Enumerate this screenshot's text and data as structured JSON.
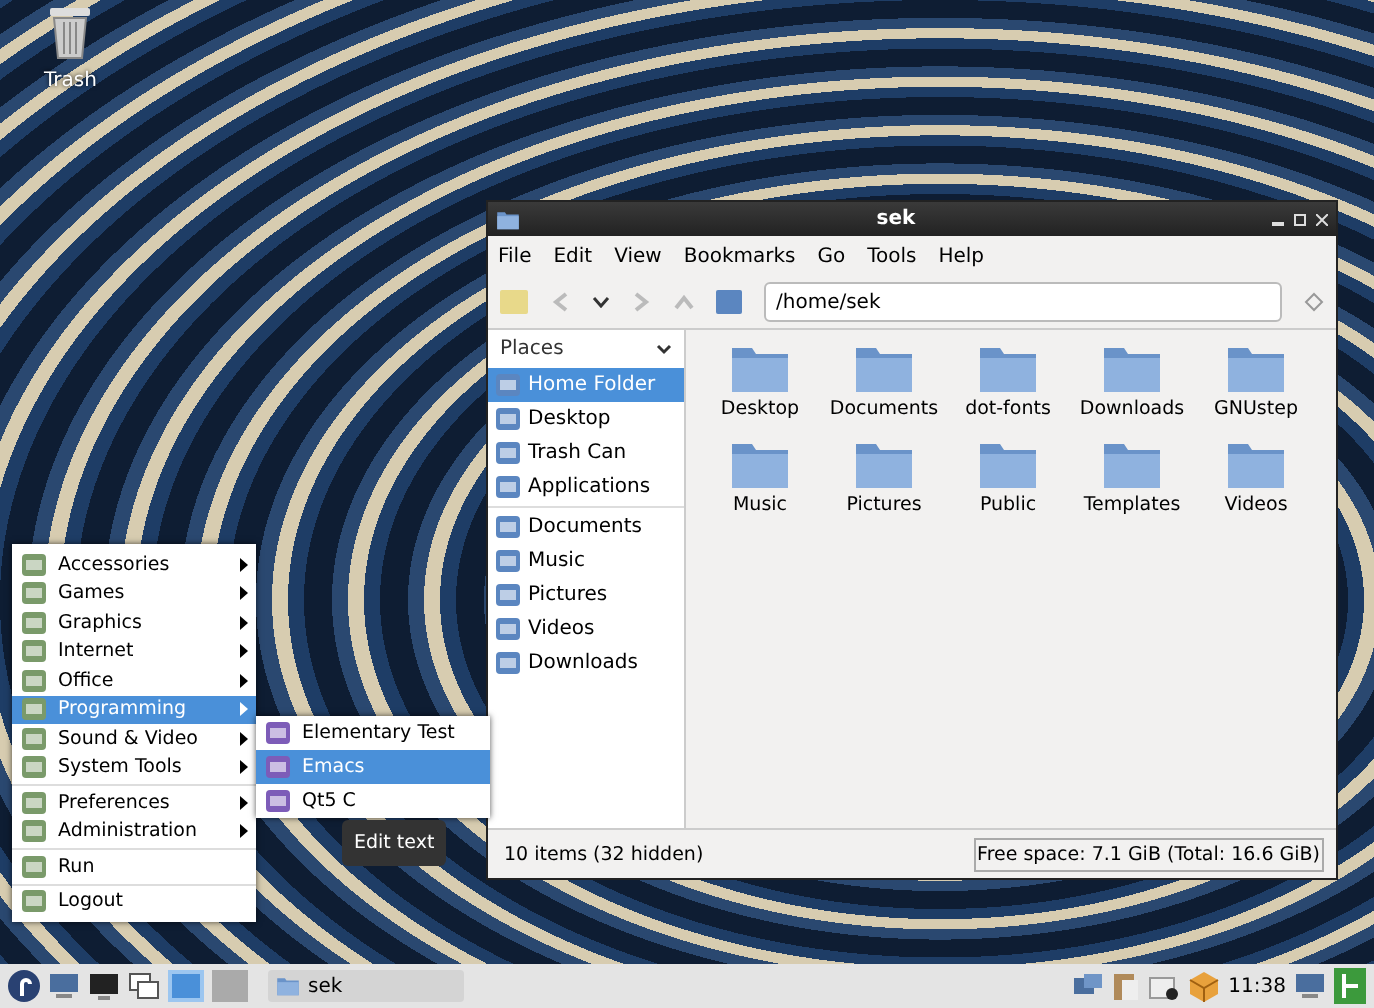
{
  "desktop_icons": [
    {
      "label": "Trash"
    }
  ],
  "file_manager": {
    "title": "sek",
    "menu": [
      "File",
      "Edit",
      "View",
      "Bookmarks",
      "Go",
      "Tools",
      "Help"
    ],
    "location": "/home/sek",
    "places_header": "Places",
    "places": [
      {
        "label": "Home Folder",
        "selected": true
      },
      {
        "label": "Desktop",
        "selected": false
      },
      {
        "label": "Trash Can",
        "selected": false
      },
      {
        "label": "Applications",
        "selected": false
      }
    ],
    "bookmarks": [
      {
        "label": "Documents",
        "selected": false
      },
      {
        "label": "Music",
        "selected": false
      },
      {
        "label": "Pictures",
        "selected": false
      },
      {
        "label": "Videos",
        "selected": false
      },
      {
        "label": "Downloads",
        "selected": false
      }
    ],
    "files": [
      "Desktop",
      "Documents",
      "dot-fonts",
      "Downloads",
      "GNUstep",
      "Music",
      "Pictures",
      "Public",
      "Templates",
      "Videos"
    ],
    "status": "10 items (32 hidden)",
    "free_space": "Free space: 7.1 GiB (Total: 16.6 GiB)"
  },
  "start_menu": {
    "groups": [
      {
        "items": [
          {
            "label": "Accessories",
            "submenu": true,
            "selected": false
          },
          {
            "label": "Games",
            "submenu": true,
            "selected": false
          },
          {
            "label": "Graphics",
            "submenu": true,
            "selected": false
          },
          {
            "label": "Internet",
            "submenu": true,
            "selected": false
          },
          {
            "label": "Office",
            "submenu": true,
            "selected": false
          },
          {
            "label": "Programming",
            "submenu": true,
            "selected": true
          },
          {
            "label": "Sound & Video",
            "submenu": true,
            "selected": false
          },
          {
            "label": "System Tools",
            "submenu": true,
            "selected": false
          }
        ]
      },
      {
        "items": [
          {
            "label": "Preferences",
            "submenu": true,
            "selected": false
          },
          {
            "label": "Administration",
            "submenu": true,
            "selected": false
          }
        ]
      },
      {
        "items": [
          {
            "label": "Run",
            "submenu": false,
            "selected": false
          }
        ]
      },
      {
        "items": [
          {
            "label": "Logout",
            "submenu": false,
            "selected": false
          }
        ]
      }
    ]
  },
  "submenu": {
    "items": [
      {
        "label": "Elementary Test",
        "selected": false
      },
      {
        "label": "Emacs",
        "selected": true
      },
      {
        "label": "Qt5 C",
        "selected": false
      }
    ],
    "tooltip": "Edit text"
  },
  "taskbar": {
    "workspaces": [
      {
        "selected": true
      },
      {
        "selected": false
      }
    ],
    "task": "sek",
    "clock": "11:38"
  }
}
